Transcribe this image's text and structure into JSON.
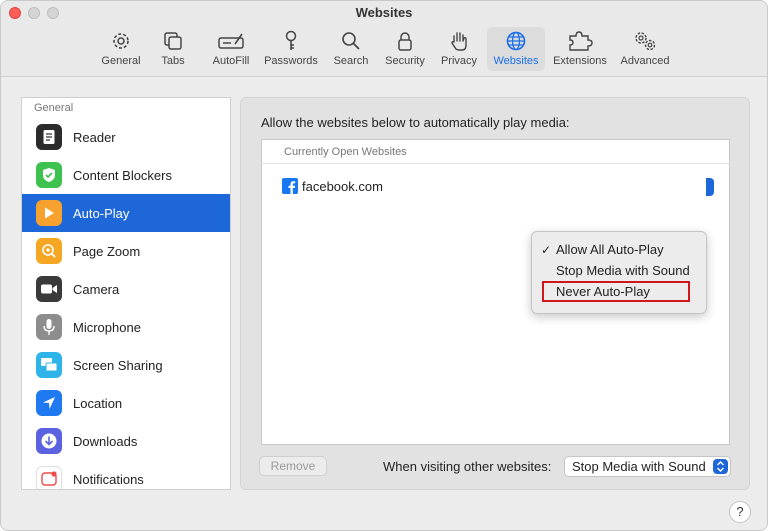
{
  "window": {
    "title": "Websites"
  },
  "toolbar": {
    "items": [
      {
        "label": "General",
        "icon": "gear-icon"
      },
      {
        "label": "Tabs",
        "icon": "tabs-icon"
      },
      {
        "label": "AutoFill",
        "icon": "autofill-icon"
      },
      {
        "label": "Passwords",
        "icon": "key-icon"
      },
      {
        "label": "Search",
        "icon": "search-icon"
      },
      {
        "label": "Security",
        "icon": "lock-icon"
      },
      {
        "label": "Privacy",
        "icon": "hand-icon"
      },
      {
        "label": "Websites",
        "icon": "globe-icon",
        "selected": true
      },
      {
        "label": "Extensions",
        "icon": "puzzle-icon"
      },
      {
        "label": "Advanced",
        "icon": "gears-icon"
      }
    ]
  },
  "sidebar": {
    "header": "General",
    "items": [
      {
        "label": "Reader",
        "icon": "reader-icon",
        "color": "#2b2b2b"
      },
      {
        "label": "Content Blockers",
        "icon": "content-blocker-icon",
        "color": "#3ec24f"
      },
      {
        "label": "Auto-Play",
        "icon": "play-icon",
        "color": "#f7a22e",
        "selected": true
      },
      {
        "label": "Page Zoom",
        "icon": "zoom-icon",
        "color": "#f5a623"
      },
      {
        "label": "Camera",
        "icon": "camera-icon",
        "color": "#3a3a3a"
      },
      {
        "label": "Microphone",
        "icon": "microphone-icon",
        "color": "#8d8d8d"
      },
      {
        "label": "Screen Sharing",
        "icon": "screen-sharing-icon",
        "color": "#2fb4e9"
      },
      {
        "label": "Location",
        "icon": "location-icon",
        "color": "#1f7af2"
      },
      {
        "label": "Downloads",
        "icon": "download-icon",
        "color": "#5a62e0"
      },
      {
        "label": "Notifications",
        "icon": "notifications-icon",
        "color": "#f04d4a"
      }
    ]
  },
  "main": {
    "description": "Allow the websites below to automatically play media:",
    "list_header": "Currently Open Websites",
    "sites": [
      {
        "name": "facebook.com",
        "icon": "facebook-icon",
        "setting": "Allow All Auto-Play"
      }
    ],
    "menu": {
      "options": [
        "Allow All Auto-Play",
        "Stop Media with Sound",
        "Never Auto-Play"
      ],
      "checked": "Allow All Auto-Play",
      "highlighted": "Never Auto-Play",
      "check_mark": "✓"
    },
    "remove_label": "Remove",
    "other_label": "When visiting other websites:",
    "other_value": "Stop Media with Sound"
  },
  "help": {
    "label": "?"
  },
  "colors": {
    "accent": "#1e67d8",
    "highlight_border": "#d0161b"
  }
}
